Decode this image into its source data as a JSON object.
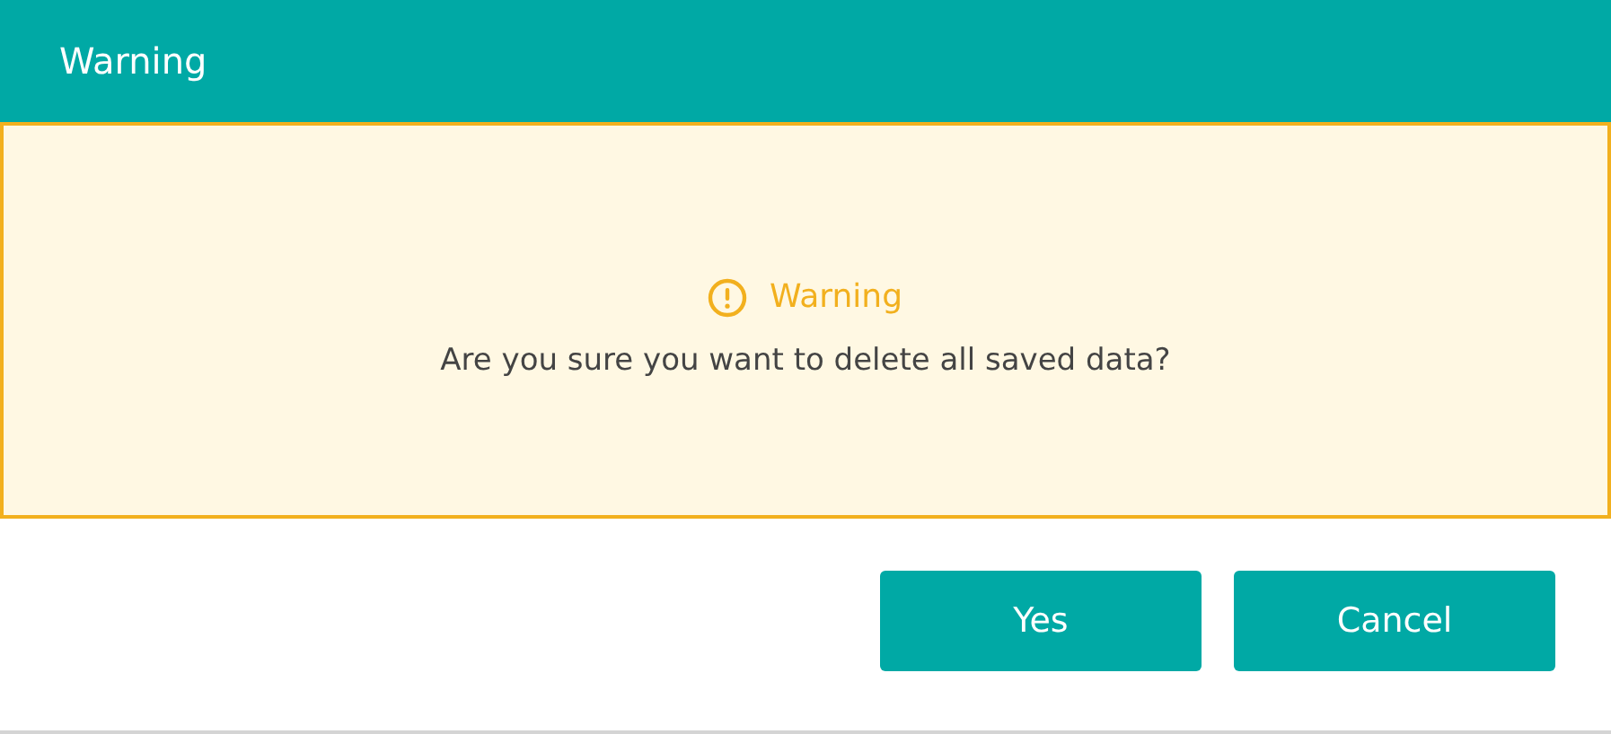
{
  "window": {
    "title": "Warning"
  },
  "alert": {
    "kind": "warning",
    "heading": "Warning",
    "message": "Are you sure you want to delete all saved data?"
  },
  "buttons": [
    {
      "label": "Yes"
    },
    {
      "label": "Cancel"
    }
  ]
}
